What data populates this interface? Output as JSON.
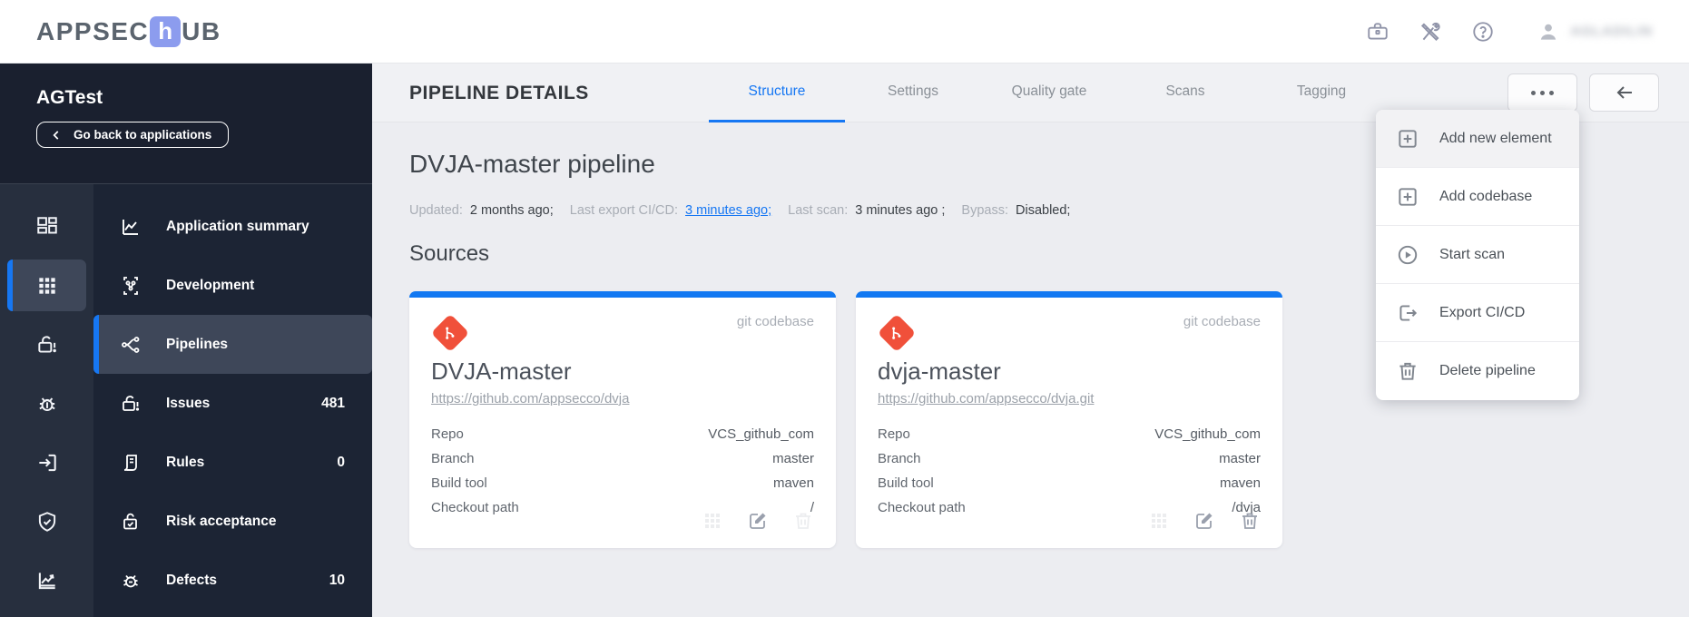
{
  "topbar": {
    "logo_prefix": "APPSEC",
    "logo_h": "h",
    "logo_suffix": "UB",
    "icons": [
      "briefcase-icon",
      "tools-icon",
      "help-icon",
      "user-icon"
    ],
    "username_blurred": "AGLADILIN"
  },
  "sidebar": {
    "app_name": "AGTest",
    "back_button_label": "Go back to applications",
    "rail_items": [
      {
        "icon": "dashboard-icon",
        "active": false
      },
      {
        "icon": "apps-grid-icon",
        "active": true
      },
      {
        "icon": "unlock-alert-icon",
        "active": false
      },
      {
        "icon": "bug-icon",
        "active": false
      },
      {
        "icon": "enter-icon",
        "active": false
      },
      {
        "icon": "shield-check-icon",
        "active": false
      },
      {
        "icon": "chart-axes-icon",
        "active": false
      }
    ],
    "menu_items": [
      {
        "label": "Application summary",
        "icon": "line-chart-icon",
        "count": "",
        "active": false
      },
      {
        "label": "Development",
        "icon": "dev-branch-icon",
        "count": "",
        "active": false
      },
      {
        "label": "Pipelines",
        "icon": "pipeline-fork-icon",
        "count": "",
        "active": true
      },
      {
        "label": "Issues",
        "icon": "unlock-alert-icon",
        "count": "481",
        "active": false
      },
      {
        "label": "Rules",
        "icon": "rules-scroll-icon",
        "count": "0",
        "active": false
      },
      {
        "label": "Risk acceptance",
        "icon": "lock-check-icon",
        "count": "",
        "active": false
      },
      {
        "label": "Defects",
        "icon": "bug-icon",
        "count": "10",
        "active": false
      }
    ]
  },
  "header": {
    "title": "PIPELINE DETAILS",
    "tabs": [
      {
        "label": "Structure",
        "active": true
      },
      {
        "label": "Settings",
        "active": false
      },
      {
        "label": "Quality gate",
        "active": false
      },
      {
        "label": "Scans",
        "active": false
      },
      {
        "label": "Tagging",
        "active": false
      }
    ],
    "buttons": [
      "more-options-button",
      "back-arrow-button"
    ]
  },
  "dropdown": {
    "items": [
      {
        "label": "Add new element",
        "icon": "plus-square-icon",
        "highlighted": true
      },
      {
        "label": "Add codebase",
        "icon": "plus-square-icon",
        "highlighted": false
      },
      {
        "label": "Start scan",
        "icon": "play-circle-icon",
        "highlighted": false
      },
      {
        "label": "Export CI/CD",
        "icon": "export-icon",
        "highlighted": false
      },
      {
        "label": "Delete pipeline",
        "icon": "trash-icon",
        "highlighted": false
      }
    ]
  },
  "pipeline": {
    "title": "DVJA-master pipeline",
    "meta": [
      {
        "label": "Updated:",
        "value": "2 months ago;",
        "link": false
      },
      {
        "label": "Last export CI/CD:",
        "value": "3 minutes ago;",
        "link": true
      },
      {
        "label": "Last scan:",
        "value": "3 minutes ago ;",
        "link": false
      },
      {
        "label": "Bypass:",
        "value": "Disabled;",
        "link": false
      }
    ]
  },
  "sources": {
    "heading": "Sources",
    "cards": [
      {
        "badge": "git codebase",
        "title": "DVJA-master",
        "url": "https://github.com/appsecco/dvja",
        "rows": [
          {
            "label": "Repo",
            "value": "VCS_github_com"
          },
          {
            "label": "Branch",
            "value": "master"
          },
          {
            "label": "Build tool",
            "value": "maven"
          },
          {
            "label": "Checkout path",
            "value": "/"
          }
        ],
        "actions": [
          {
            "icon": "grid-icon",
            "disabled": true
          },
          {
            "icon": "edit-icon",
            "disabled": false
          },
          {
            "icon": "trash-icon",
            "disabled": true
          }
        ]
      },
      {
        "badge": "git codebase",
        "title": "dvja-master",
        "url": "https://github.com/appsecco/dvja.git",
        "rows": [
          {
            "label": "Repo",
            "value": "VCS_github_com"
          },
          {
            "label": "Branch",
            "value": "master"
          },
          {
            "label": "Build tool",
            "value": "maven"
          },
          {
            "label": "Checkout path",
            "value": "/dvja"
          }
        ],
        "actions": [
          {
            "icon": "grid-icon",
            "disabled": true
          },
          {
            "icon": "edit-icon",
            "disabled": false
          },
          {
            "icon": "trash-icon",
            "disabled": false
          }
        ]
      }
    ]
  },
  "colors": {
    "accent_blue": "#1677f3",
    "card_bar_blue": "#1178f2",
    "git_orange": "#f0503a",
    "sidebar_top": "#1a202f",
    "rail_bg": "#272f3e",
    "menu_bg": "#1c2434",
    "active_item_bg": "#3e4759"
  }
}
